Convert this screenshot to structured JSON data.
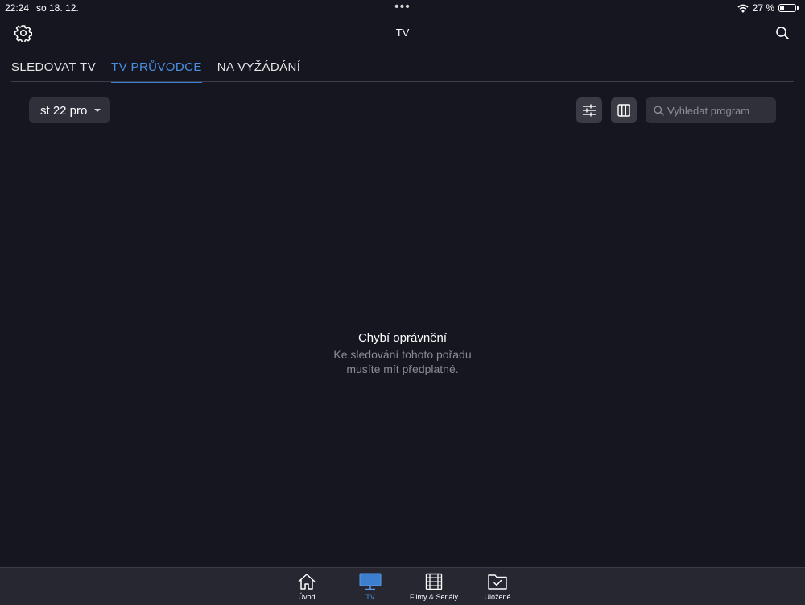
{
  "status_bar": {
    "time": "22:24",
    "date": "so 18. 12.",
    "battery": "27 %",
    "battery_level": 0.27,
    "dots": "•••"
  },
  "header": {
    "title": "TV"
  },
  "tabs": [
    {
      "label": "SLEDOVAT TV",
      "active": false
    },
    {
      "label": "TV PRŮVODCE",
      "active": true
    },
    {
      "label": "NA VYŽÁDÁNÍ",
      "active": false
    }
  ],
  "toolbar": {
    "date_value": "st 22 pro",
    "search_placeholder": "Vyhledat program"
  },
  "message": {
    "title": "Chybí oprávnění",
    "line1": "Ke sledování tohoto pořadu",
    "line2": "musíte mít předplatné."
  },
  "bottom_nav": [
    {
      "label": "Úvod",
      "icon": "home-icon"
    },
    {
      "label": "TV",
      "icon": "tv-icon",
      "active": true
    },
    {
      "label": "Filmy & Seriály",
      "icon": "film-icon"
    },
    {
      "label": "Uložené",
      "icon": "saved-folder-icon"
    }
  ],
  "colors": {
    "background": "#151620",
    "accent": "#4a90e2",
    "tabbar": "#262730"
  }
}
